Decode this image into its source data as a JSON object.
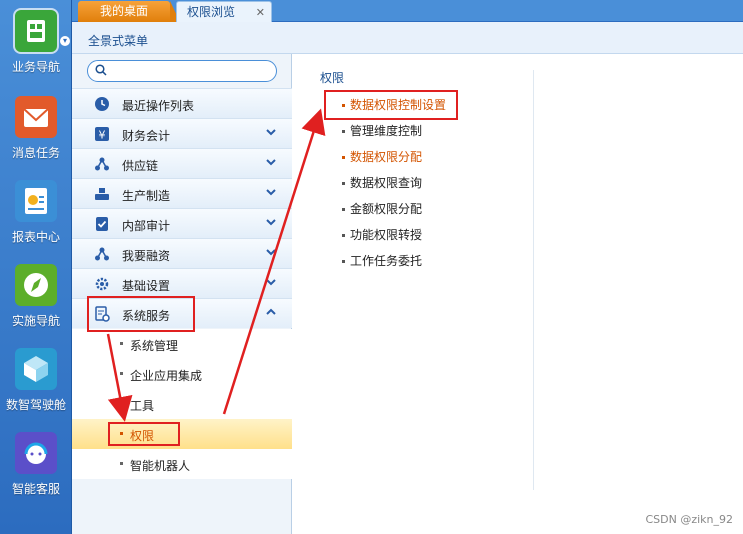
{
  "tabs": {
    "home": "我的桌面",
    "permission": "权限浏览",
    "close": "✕"
  },
  "rail": [
    {
      "label": "业务导航",
      "icon": "business-nav-icon",
      "color": "#3aa63a"
    },
    {
      "label": "消息任务",
      "icon": "message-task-icon",
      "color": "#e25a2b"
    },
    {
      "label": "报表中心",
      "icon": "report-center-icon",
      "color": "#3b8fd6"
    },
    {
      "label": "实施导航",
      "icon": "implementation-nav-icon",
      "color": "#5cae2a"
    },
    {
      "label": "数智驾驶舱",
      "icon": "cockpit-icon",
      "color": "#2a9bd0"
    },
    {
      "label": "智能客服",
      "icon": "smart-service-icon",
      "color": "#5b4fc9"
    }
  ],
  "panel": {
    "title": "全景式菜单"
  },
  "menu": {
    "items": [
      {
        "label": "最近操作列表",
        "chevron": false
      },
      {
        "label": "财务会计",
        "chevron": true
      },
      {
        "label": "供应链",
        "chevron": true
      },
      {
        "label": "生产制造",
        "chevron": true
      },
      {
        "label": "内部审计",
        "chevron": true
      },
      {
        "label": "我要融资",
        "chevron": true
      },
      {
        "label": "基础设置",
        "chevron": true
      },
      {
        "label": "系统服务",
        "chevron": true
      }
    ],
    "sub_items": [
      {
        "label": "系统管理"
      },
      {
        "label": "企业应用集成"
      },
      {
        "label": "工具"
      },
      {
        "label": "权限"
      },
      {
        "label": "智能机器人"
      }
    ]
  },
  "content": {
    "title": "权限",
    "links": [
      {
        "label": "数据权限控制设置"
      },
      {
        "label": "管理维度控制"
      },
      {
        "label": "数据权限分配"
      },
      {
        "label": "数据权限查询"
      },
      {
        "label": "金额权限分配"
      },
      {
        "label": "功能权限转授"
      },
      {
        "label": "工作任务委托"
      }
    ]
  },
  "watermark": "CSDN @zikn_92",
  "colors": {
    "accent": "#2c6cbf",
    "orange": "#d35400",
    "highlight": "#e02020"
  }
}
